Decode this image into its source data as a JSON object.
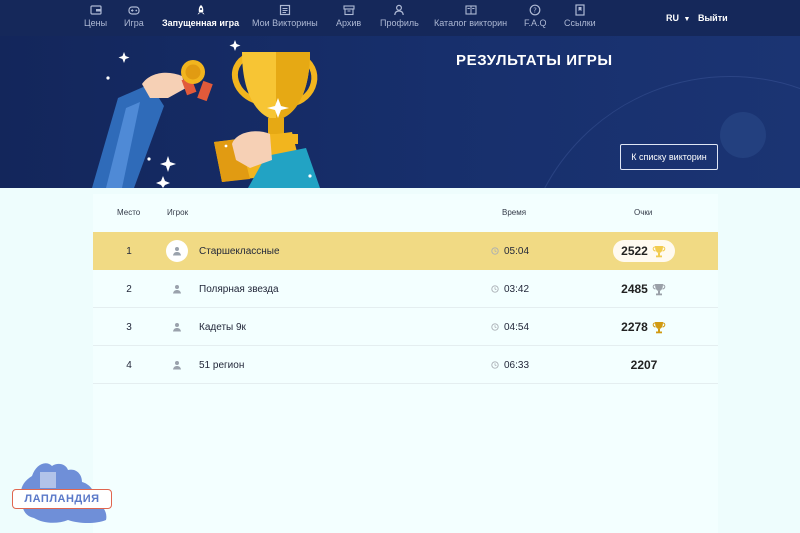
{
  "nav": {
    "items": [
      {
        "label": "Цены",
        "icon": "wallet-icon"
      },
      {
        "label": "Игра",
        "icon": "gamepad-icon"
      },
      {
        "label": "Запущенная игра",
        "icon": "rocket-icon"
      },
      {
        "label": "Мои Викторины",
        "icon": "quiz-list-icon"
      },
      {
        "label": "Архив",
        "icon": "archive-icon"
      },
      {
        "label": "Профиль",
        "icon": "user-icon"
      },
      {
        "label": "Каталог викторин",
        "icon": "catalog-icon"
      },
      {
        "label": "F.A.Q",
        "icon": "question-icon"
      },
      {
        "label": "Ссылки",
        "icon": "bookmark-icon"
      }
    ],
    "active": "Запущенная игра",
    "lang": "RU",
    "logout": "Выйти"
  },
  "banner": {
    "title": "РЕЗУЛЬТАТЫ ИГРЫ",
    "back_button": "К списку викторин"
  },
  "table": {
    "headers": {
      "place": "Место",
      "player": "Игрок",
      "time": "Время",
      "score": "Очки"
    },
    "rows": [
      {
        "place": "1",
        "name": "Старшеклассные",
        "time": "05:04",
        "score": "2522",
        "trophy": "gold",
        "highlight": true
      },
      {
        "place": "2",
        "name": "Полярная звезда",
        "time": "03:42",
        "score": "2485",
        "trophy": "silver",
        "highlight": false
      },
      {
        "place": "3",
        "name": "Кадеты 9к",
        "time": "04:54",
        "score": "2278",
        "trophy": "bronze",
        "highlight": false
      },
      {
        "place": "4",
        "name": "51 регион",
        "time": "06:33",
        "score": "2207",
        "trophy": "none",
        "highlight": false
      }
    ]
  },
  "logo": {
    "text": "ЛАПЛАНДИЯ"
  },
  "colors": {
    "nav_bg": "#15285a",
    "banner_bg": "#172f6c",
    "highlight_row": "#f1da84",
    "trophy_gold": "#e9b21a",
    "trophy_silver": "#9aa0a8",
    "trophy_bronze": "#d19a12",
    "page_bg": "#eefdfd"
  }
}
